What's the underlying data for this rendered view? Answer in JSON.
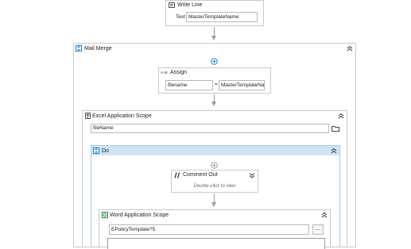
{
  "write_line": {
    "title": "Write Line",
    "text_label": "Text",
    "text_value": "MasterTemplateName"
  },
  "mail_merge": {
    "title": "Mail Merge"
  },
  "assign": {
    "title": "Assign",
    "icon_text": "A+B",
    "left_value": "filename",
    "operator": "=",
    "right_value": "MasterTemplateNa"
  },
  "excel_scope": {
    "title": "Excel Application Scope",
    "path_value": "fileName"
  },
  "do_seq": {
    "title": "Do"
  },
  "comment_out": {
    "title": "Comment Out",
    "hint": "Double-click to view"
  },
  "word_scope": {
    "title": "Word Application Scope",
    "path_value": "EPolicyTemplate?5",
    "browse_label": "..."
  },
  "icons": [
    "write-line-icon",
    "sequence-icon",
    "assign-icon",
    "excel-icon",
    "folder-icon",
    "comment-out-icon",
    "word-icon",
    "collapse-icon",
    "expand-icon",
    "add-activity-icon"
  ],
  "colors": {
    "accent_blue": "#1e7fd6",
    "do_header_bg": "#cfe3f5",
    "border": "#c9c9c9",
    "connector": "#9b9b9b"
  }
}
